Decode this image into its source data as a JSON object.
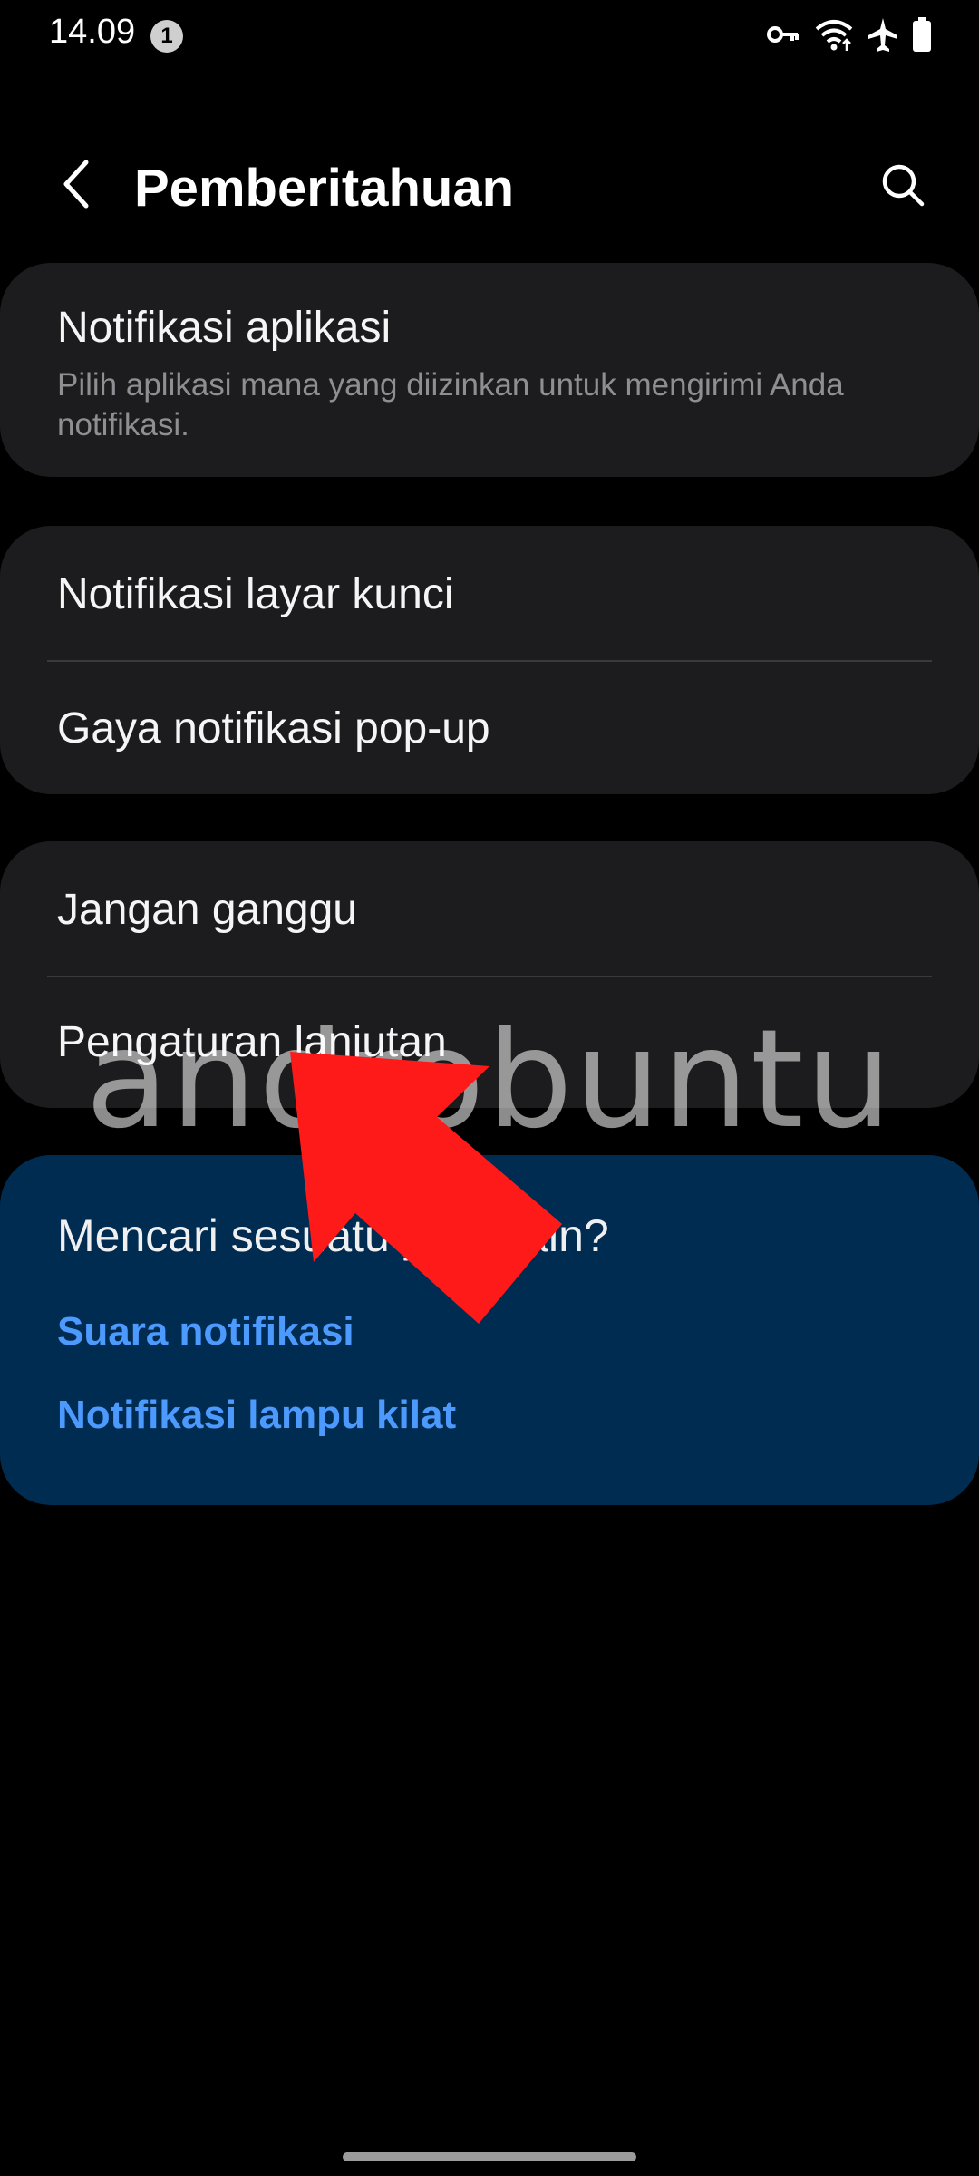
{
  "status_bar": {
    "time": "14.09",
    "notification_count": "1",
    "icons": [
      "key-icon",
      "wifi-icon",
      "airplane-icon",
      "battery-icon"
    ]
  },
  "header": {
    "title": "Pemberitahuan",
    "back_icon": "back-arrow-icon",
    "search_icon": "search-icon"
  },
  "cards": {
    "app_notifications": {
      "title": "Notifikasi aplikasi",
      "subtitle_line1": "Pilih aplikasi mana yang diizinkan untuk mengirimi Anda",
      "subtitle_line2": "notifikasi."
    },
    "lock_screen": {
      "title": "Notifikasi layar kunci"
    },
    "popup_style": {
      "title": "Gaya notifikasi pop-up"
    },
    "dnd": {
      "title": "Jangan ganggu"
    },
    "advanced": {
      "title": "Pengaturan lanjutan"
    }
  },
  "suggestions": {
    "title": "Mencari sesuatu yang lain?",
    "links": [
      "Suara notifikasi",
      "Notifikasi lampu kilat"
    ]
  },
  "overlay": {
    "watermark": "androbuntu",
    "arrow_color": "#ff1a1a"
  },
  "colors": {
    "background": "#000000",
    "card": "#1c1c1e",
    "suggest_card": "#012c52",
    "link": "#4d9aff"
  }
}
